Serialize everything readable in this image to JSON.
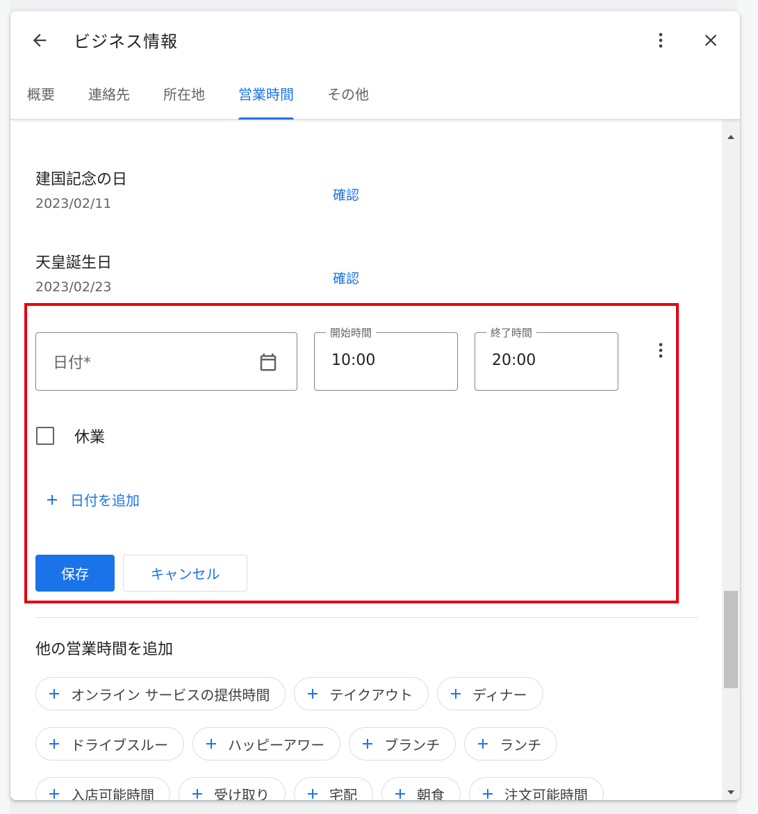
{
  "header": {
    "title": "ビジネス情報",
    "back_icon": "arrow-left-icon",
    "more_icon": "more-vert-icon",
    "close_icon": "close-icon"
  },
  "tabs": [
    {
      "label": "概要",
      "active": false
    },
    {
      "label": "連絡先",
      "active": false
    },
    {
      "label": "所在地",
      "active": false
    },
    {
      "label": "営業時間",
      "active": true
    },
    {
      "label": "その他",
      "active": false
    }
  ],
  "holidays": [
    {
      "name": "建国記念の日",
      "date": "2023/02/11",
      "action": "確認"
    },
    {
      "name": "天皇誕生日",
      "date": "2023/02/23",
      "action": "確認"
    }
  ],
  "special_hours_form": {
    "date_placeholder": "日付*",
    "start_label": "開始時間",
    "start_value": "10:00",
    "end_label": "終了時間",
    "end_value": "20:00",
    "closed_label": "休業",
    "add_date_label": "日付を追加",
    "save_label": "保存",
    "cancel_label": "キャンセル"
  },
  "more_hours": {
    "title": "他の営業時間を追加",
    "rows": [
      [
        "オンライン サービスの提供時間",
        "テイクアウト",
        "ディナー"
      ],
      [
        "ドライブスルー",
        "ハッピーアワー",
        "ブランチ",
        "ランチ"
      ],
      [
        "入店可能時間",
        "受け取り",
        "宅配",
        "朝食",
        "注文可能時間"
      ]
    ]
  },
  "colors": {
    "accent": "#1a73e8",
    "highlight_box": "#e60012"
  }
}
